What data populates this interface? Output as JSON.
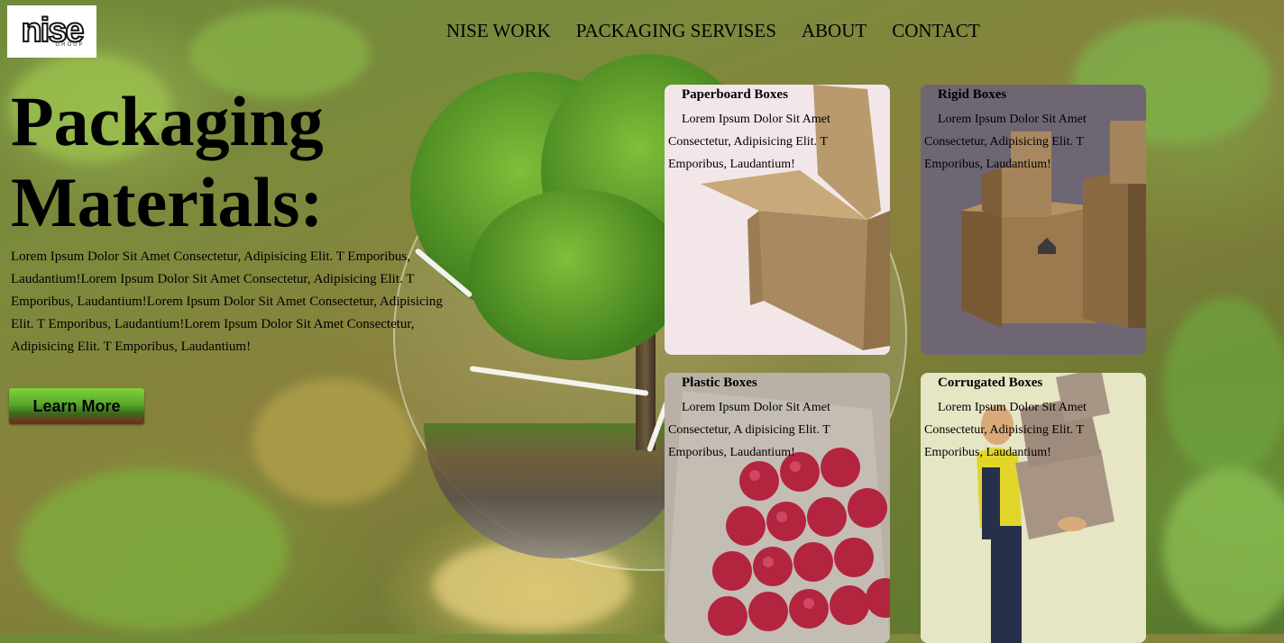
{
  "header": {
    "logo_text": "nise",
    "logo_sub": "GROUP",
    "nav": [
      "NISE WORK",
      "PACKAGING SERVISES",
      "ABOUT",
      "CONTACT"
    ]
  },
  "hero": {
    "title_line1": "Packaging",
    "title_line2": "Materials:",
    "body": "Lorem Ipsum Dolor Sit Amet Consectetur, Adipisicing Elit. T Emporibus, Laudantium!Lorem Ipsum Dolor Sit Amet Consectetur, Adipisicing Elit. T Emporibus, Laudantium!Lorem Ipsum Dolor Sit Amet Consectetur, Adipisicing Elit. T Emporibus, Laudantium!Lorem Ipsum Dolor Sit Amet Consectetur, Adipisicing Elit. T Emporibus, Laudantium!",
    "button": "Learn More"
  },
  "cards": [
    {
      "title": "Paperboard Boxes",
      "text": "Lorem Ipsum Dolor Sit Amet Consectetur, Adipisicing Elit. T Emporibus, Laudantium!"
    },
    {
      "title": "Rigid Boxes",
      "text": "Lorem Ipsum Dolor Sit Amet Consectetur, Adipisicing Elit. T Emporibus, Laudantium!"
    },
    {
      "title": "Plastic Boxes",
      "text": "Lorem Ipsum Dolor Sit Amet Consectetur, A dipisicing Elit. T Emporibus, Laudantium!"
    },
    {
      "title": "Corrugated Boxes",
      "text": "Lorem Ipsum Dolor Sit Amet Consectetur, Adipisicing Elit. T Emporibus, Laudantium!"
    }
  ],
  "colors": {
    "button_top": "#7fd13b",
    "button_bottom": "#7a2818",
    "card_paperboard": "#f2e6e9",
    "card_rigid": "#6e6570",
    "card_corrugated": "#e6e5c4"
  }
}
